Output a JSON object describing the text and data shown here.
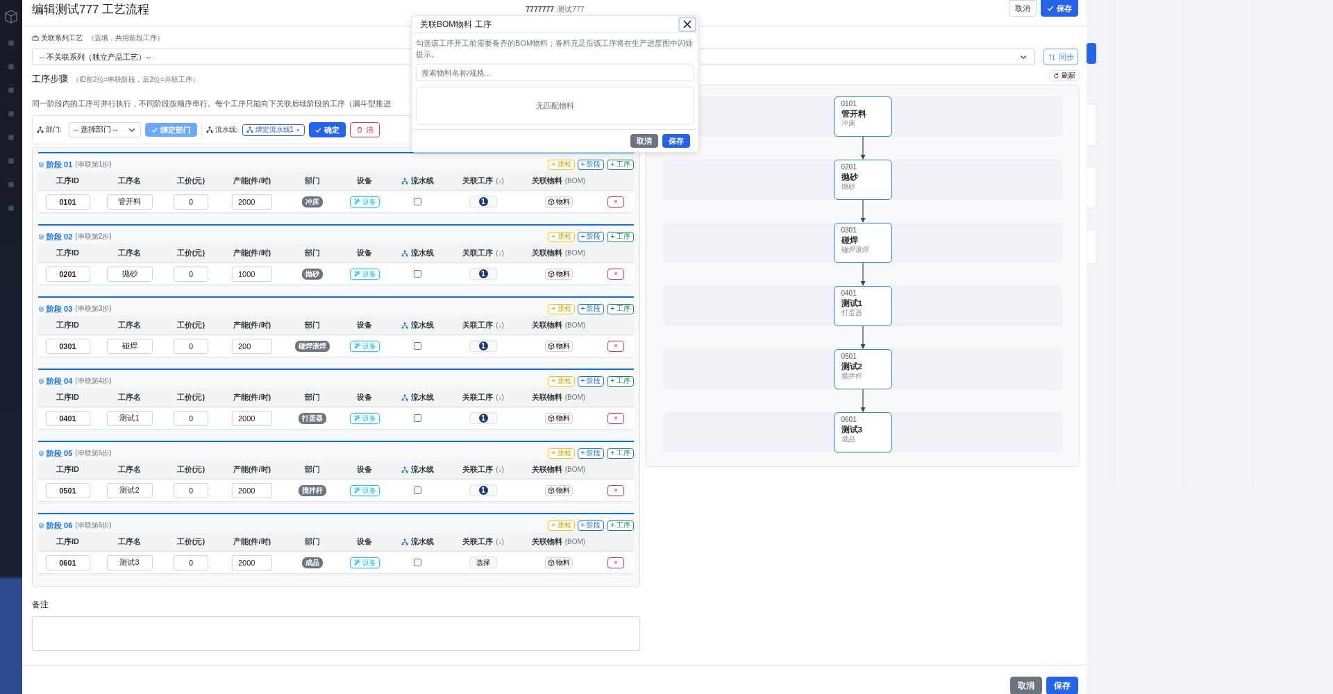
{
  "dialog": {
    "title": "编辑测试777 工艺流程",
    "code": "7777777",
    "product": "测试777",
    "header_buttons": [
      {
        "label": "取消",
        "kind": "outline"
      },
      {
        "label": "保存",
        "kind": "primary"
      }
    ],
    "series": {
      "label": "关联系列工艺",
      "hint": "（选填，共用前段工序）",
      "value": "-- 不关联系列（独立产品工艺）--",
      "sync_button": "同步"
    },
    "steps": {
      "title": "工序步骤",
      "hint": "（ID前2位=串联阶段，后2位=并联工序）",
      "description": "同一阶段内的工序可并行执行，不同阶段按顺序串行。每个工序只能向下关联后续阶段的工序（漏斗型推进"
    },
    "toolbar": {
      "dept_label": "部门:",
      "dept_value": "-- 选择部门 --",
      "bind_dept": "绑定部门",
      "line_label": "流水线:",
      "line_value": "绑定流水线1",
      "confirm": "确定",
      "clear": "清"
    },
    "stages": [
      {
        "title": "阶段 01",
        "note": "(串联第1步)",
        "actions": [
          {
            "label": "+ 质检",
            "kind": "quality"
          },
          {
            "label": "+ 阶段",
            "kind": "stage"
          },
          {
            "label": "+ 工序",
            "kind": "step"
          }
        ],
        "columns": [
          {
            "label": "工序ID",
            "kind": "plain"
          },
          {
            "label": "工序名",
            "kind": "plain"
          },
          {
            "label": "工价(元)",
            "kind": "plain"
          },
          {
            "label": "产能(件/时)",
            "kind": "plain"
          },
          {
            "label": "部门",
            "kind": "plain"
          },
          {
            "label": "设备",
            "kind": "plain"
          },
          {
            "label": "流水线",
            "kind": "icon"
          },
          {
            "label": "关联工序",
            "note": "(↓)",
            "kind": "note"
          },
          {
            "label": "关联物料",
            "note": "(BOM)",
            "kind": "note"
          }
        ],
        "rows": [
          {
            "id": "0101",
            "name": "管开料",
            "price": "0",
            "capacity": "2000",
            "dept": "冲床",
            "equipment": "设备",
            "pipeline_checked": false,
            "link": {
              "kind": "count",
              "label": "1"
            },
            "bom": "物料",
            "remove": "×"
          }
        ]
      },
      {
        "title": "阶段 02",
        "note": "(串联第2步)",
        "actions": [
          {
            "label": "+ 质检",
            "kind": "quality"
          },
          {
            "label": "+ 阶段",
            "kind": "stage"
          },
          {
            "label": "+ 工序",
            "kind": "step"
          }
        ],
        "columns": [
          {
            "label": "工序ID",
            "kind": "plain"
          },
          {
            "label": "工序名",
            "kind": "plain"
          },
          {
            "label": "工价(元)",
            "kind": "plain"
          },
          {
            "label": "产能(件/时)",
            "kind": "plain"
          },
          {
            "label": "部门",
            "kind": "plain"
          },
          {
            "label": "设备",
            "kind": "plain"
          },
          {
            "label": "流水线",
            "kind": "icon"
          },
          {
            "label": "关联工序",
            "note": "(↓)",
            "kind": "note"
          },
          {
            "label": "关联物料",
            "note": "(BOM)",
            "kind": "note"
          }
        ],
        "rows": [
          {
            "id": "0201",
            "name": "抛砂",
            "price": "0",
            "capacity": "1000",
            "dept": "抛砂",
            "equipment": "设备",
            "pipeline_checked": false,
            "link": {
              "kind": "count",
              "label": "1"
            },
            "bom": "物料",
            "remove": "×"
          }
        ]
      },
      {
        "title": "阶段 03",
        "note": "(串联第3步)",
        "actions": [
          {
            "label": "+ 质检",
            "kind": "quality"
          },
          {
            "label": "+ 阶段",
            "kind": "stage"
          },
          {
            "label": "+ 工序",
            "kind": "step"
          }
        ],
        "columns": [
          {
            "label": "工序ID",
            "kind": "plain"
          },
          {
            "label": "工序名",
            "kind": "plain"
          },
          {
            "label": "工价(元)",
            "kind": "plain"
          },
          {
            "label": "产能(件/时)",
            "kind": "plain"
          },
          {
            "label": "部门",
            "kind": "plain"
          },
          {
            "label": "设备",
            "kind": "plain"
          },
          {
            "label": "流水线",
            "kind": "icon"
          },
          {
            "label": "关联工序",
            "note": "(↓)",
            "kind": "note"
          },
          {
            "label": "关联物料",
            "note": "(BOM)",
            "kind": "note"
          }
        ],
        "rows": [
          {
            "id": "0301",
            "name": "碰焊",
            "price": "0",
            "capacity": "200",
            "dept": "碰焊滚焊",
            "equipment": "设备",
            "pipeline_checked": false,
            "link": {
              "kind": "count",
              "label": "1"
            },
            "bom": "物料",
            "remove": "×"
          }
        ]
      },
      {
        "title": "阶段 04",
        "note": "(串联第4步)",
        "actions": [
          {
            "label": "+ 质检",
            "kind": "quality"
          },
          {
            "label": "+ 阶段",
            "kind": "stage"
          },
          {
            "label": "+ 工序",
            "kind": "step"
          }
        ],
        "columns": [
          {
            "label": "工序ID",
            "kind": "plain"
          },
          {
            "label": "工序名",
            "kind": "plain"
          },
          {
            "label": "工价(元)",
            "kind": "plain"
          },
          {
            "label": "产能(件/时)",
            "kind": "plain"
          },
          {
            "label": "部门",
            "kind": "plain"
          },
          {
            "label": "设备",
            "kind": "plain"
          },
          {
            "label": "流水线",
            "kind": "icon"
          },
          {
            "label": "关联工序",
            "note": "(↓)",
            "kind": "note"
          },
          {
            "label": "关联物料",
            "note": "(BOM)",
            "kind": "note"
          }
        ],
        "rows": [
          {
            "id": "0401",
            "name": "测试1",
            "price": "0",
            "capacity": "2000",
            "dept": "打蛋器",
            "equipment": "设备",
            "pipeline_checked": false,
            "link": {
              "kind": "count",
              "label": "1"
            },
            "bom": "物料",
            "remove": "×"
          }
        ]
      },
      {
        "title": "阶段 05",
        "note": "(串联第5步)",
        "actions": [
          {
            "label": "+ 质检",
            "kind": "quality"
          },
          {
            "label": "+ 阶段",
            "kind": "stage"
          },
          {
            "label": "+ 工序",
            "kind": "step"
          }
        ],
        "columns": [
          {
            "label": "工序ID",
            "kind": "plain"
          },
          {
            "label": "工序名",
            "kind": "plain"
          },
          {
            "label": "工价(元)",
            "kind": "plain"
          },
          {
            "label": "产能(件/时)",
            "kind": "plain"
          },
          {
            "label": "部门",
            "kind": "plain"
          },
          {
            "label": "设备",
            "kind": "plain"
          },
          {
            "label": "流水线",
            "kind": "icon"
          },
          {
            "label": "关联工序",
            "note": "(↓)",
            "kind": "note"
          },
          {
            "label": "关联物料",
            "note": "(BOM)",
            "kind": "note"
          }
        ],
        "rows": [
          {
            "id": "0501",
            "name": "测试2",
            "price": "0",
            "capacity": "2000",
            "dept": "搅拌杆",
            "equipment": "设备",
            "pipeline_checked": false,
            "link": {
              "kind": "count",
              "label": "1"
            },
            "bom": "物料",
            "remove": "×"
          }
        ]
      },
      {
        "title": "阶段 06",
        "note": "(串联第6步)",
        "actions": [
          {
            "label": "+ 质检",
            "kind": "quality"
          },
          {
            "label": "+ 阶段",
            "kind": "stage"
          },
          {
            "label": "+ 工序",
            "kind": "step"
          }
        ],
        "columns": [
          {
            "label": "工序ID",
            "kind": "plain"
          },
          {
            "label": "工序名",
            "kind": "plain"
          },
          {
            "label": "工价(元)",
            "kind": "plain"
          },
          {
            "label": "产能(件/时)",
            "kind": "plain"
          },
          {
            "label": "部门",
            "kind": "plain"
          },
          {
            "label": "设备",
            "kind": "plain"
          },
          {
            "label": "流水线",
            "kind": "icon"
          },
          {
            "label": "关联工序",
            "note": "(↓)",
            "kind": "note"
          },
          {
            "label": "关联物料",
            "note": "(BOM)",
            "kind": "note"
          }
        ],
        "rows": [
          {
            "id": "0601",
            "name": "测试3",
            "price": "0",
            "capacity": "2000",
            "dept": "成品",
            "equipment": "设备",
            "pipeline_checked": false,
            "link": {
              "kind": "select",
              "label": "选择"
            },
            "bom": "物料",
            "remove": "×"
          }
        ]
      }
    ],
    "remarks": {
      "label": "备注"
    },
    "flow": {
      "refresh_button": "刷新",
      "nodes": [
        {
          "id": "0101",
          "name": "管开料",
          "dept": "冲床"
        },
        {
          "id": "0201",
          "name": "抛砂",
          "dept": "抛砂"
        },
        {
          "id": "0301",
          "name": "碰焊",
          "dept": "碰焊滚焊"
        },
        {
          "id": "0401",
          "name": "测试1",
          "dept": "打蛋器"
        },
        {
          "id": "0501",
          "name": "测试2",
          "dept": "搅拌杆"
        },
        {
          "id": "0601",
          "name": "测试3",
          "dept": "成品"
        }
      ]
    },
    "footer_buttons": [
      {
        "label": "取消",
        "kind": "secondary"
      },
      {
        "label": "保存",
        "kind": "primary"
      }
    ]
  },
  "bom_popup": {
    "title": "关联BOM物料 工序",
    "hint": "勾选该工序开工前需要备齐的BOM物料；备料充足后该工序将在生产进度图中闪烁提示。",
    "search_placeholder": "搜索物料名称/规格...",
    "empty_text": "无匹配物料",
    "buttons": [
      {
        "label": "取消",
        "kind": "secondary"
      },
      {
        "label": "保存",
        "kind": "primary"
      }
    ]
  }
}
